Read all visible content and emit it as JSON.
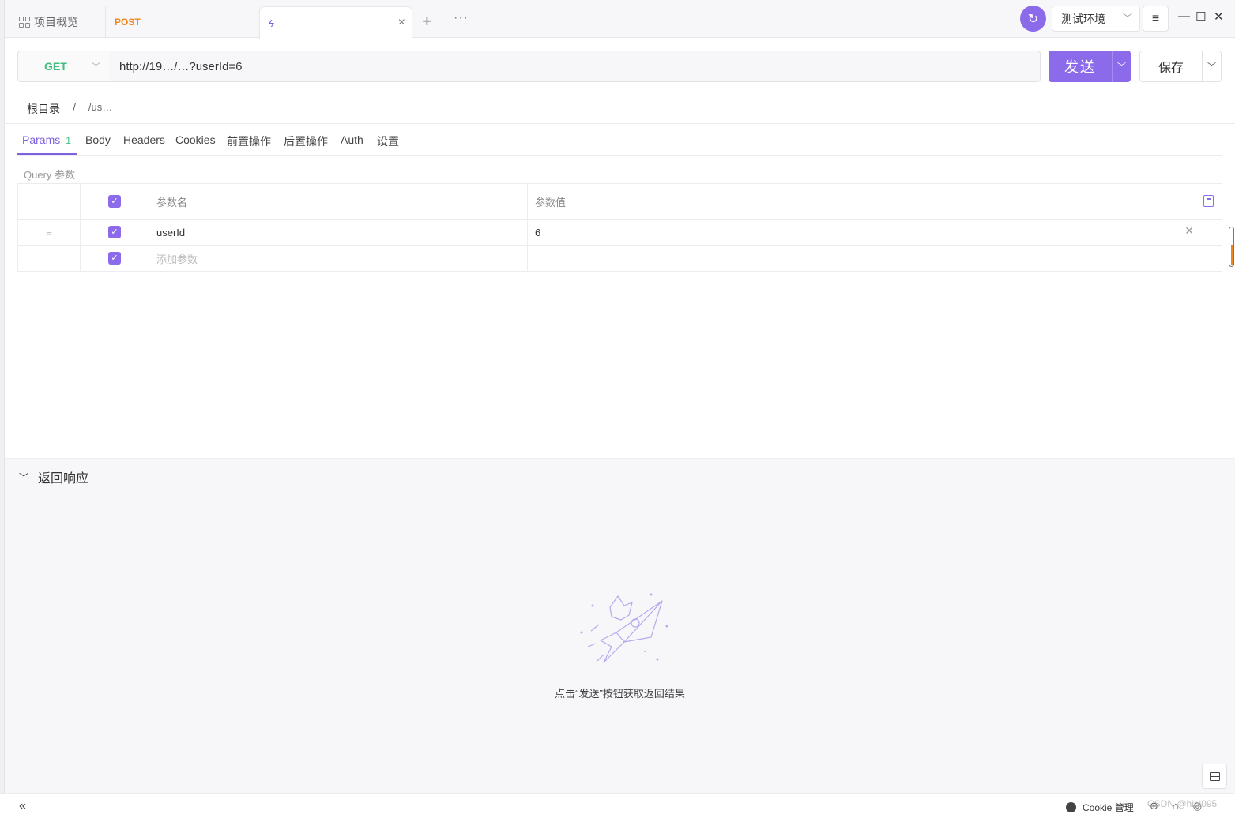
{
  "tabs": {
    "overview_label": "项目概览",
    "post_method": "POST",
    "post_title": "",
    "active_title": "",
    "close_glyph": "×",
    "plus_glyph": "+",
    "more_glyph": "···"
  },
  "toolbar": {
    "env_label": "测试环境",
    "menu_glyph": "≡",
    "minimize_glyph": "—",
    "maximize_glyph": "☐",
    "close_glyph": "✕",
    "sync_glyph": "↻"
  },
  "request": {
    "method": "GET",
    "url": "http://19…/…?userId=6",
    "send_label": "发送",
    "save_label": "保存"
  },
  "breadcrumb": {
    "root": "根目录",
    "separator": "/",
    "path": "/us…"
  },
  "req_tabs": [
    {
      "label": "Params",
      "count": "1"
    },
    {
      "label": "Body"
    },
    {
      "label": "Headers"
    },
    {
      "label": "Cookies"
    },
    {
      "label": "前置操作"
    },
    {
      "label": "后置操作"
    },
    {
      "label": "Auth"
    },
    {
      "label": "设置"
    }
  ],
  "query": {
    "section_label": "Query 参数",
    "col_name": "参数名",
    "col_value": "参数值",
    "rows": [
      {
        "checked": true,
        "name": "userId",
        "value": "6"
      }
    ],
    "add_placeholder": "添加参数"
  },
  "response": {
    "title": "返回响应",
    "empty_text": "点击“发送”按钮获取返回结果"
  },
  "statusbar": {
    "cookie_label": "Cookie 管理",
    "watermark": "CSDN @hipi095"
  },
  "colors": {
    "accent": "#8b6bea",
    "get_method": "#3fbe7f",
    "post_method": "#f0861a"
  },
  "icons": [
    "grid-icon",
    "bolt-icon",
    "sync-icon",
    "menu-icon",
    "checkbox-icon",
    "bulk-edit-icon",
    "rocket-fox-illustration",
    "layout-icon",
    "cookie-icon"
  ]
}
